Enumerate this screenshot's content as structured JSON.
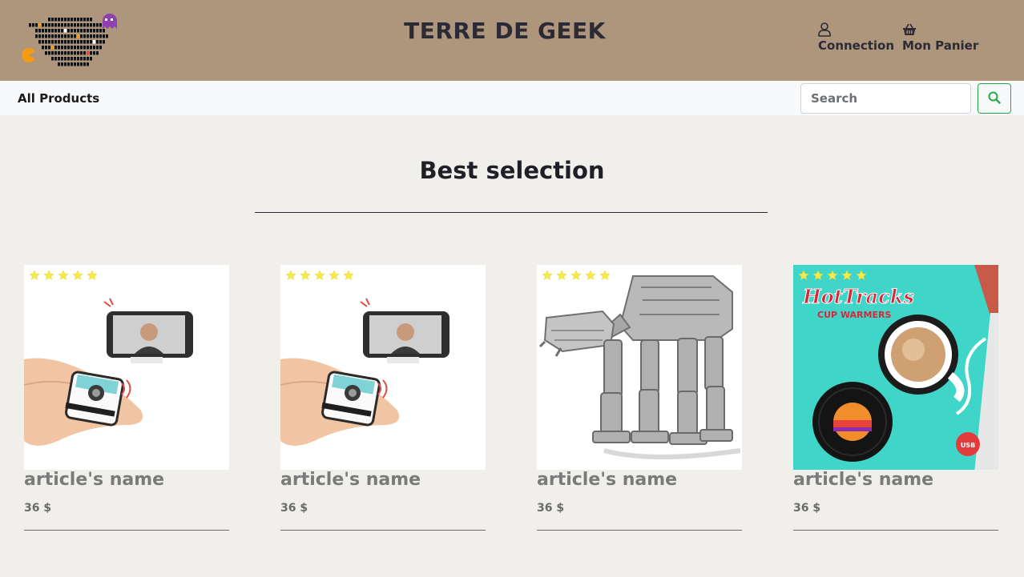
{
  "header": {
    "title": "TERRE DE GEEK",
    "logo_icon": "pixel-map-pacman-logo",
    "connection_label": "Connection",
    "connection_icon": "user-icon",
    "cart_label": "Mon Panier",
    "cart_icon": "basket-icon"
  },
  "nav": {
    "all_products": "All Products",
    "search_placeholder": "Search",
    "search_icon": "search-icon"
  },
  "section": {
    "title": "Best selection"
  },
  "products": [
    {
      "name": "article's name",
      "price": "36 $",
      "rating": 5,
      "image": "selfie-remote-camera"
    },
    {
      "name": "article's name",
      "price": "36 $",
      "rating": 5,
      "image": "selfie-remote-camera"
    },
    {
      "name": "article's name",
      "price": "36 $",
      "rating": 5,
      "image": "metal-walker-model"
    },
    {
      "name": "article's name",
      "price": "36 $",
      "rating": 5,
      "image": "hottracks-cup-warmer"
    }
  ],
  "colors": {
    "header_bg": "#ad967b",
    "page_bg": "#f1efec",
    "navbar_bg": "#f8f9fa",
    "search_accent": "#28a745",
    "star": "#f7ea4a"
  }
}
